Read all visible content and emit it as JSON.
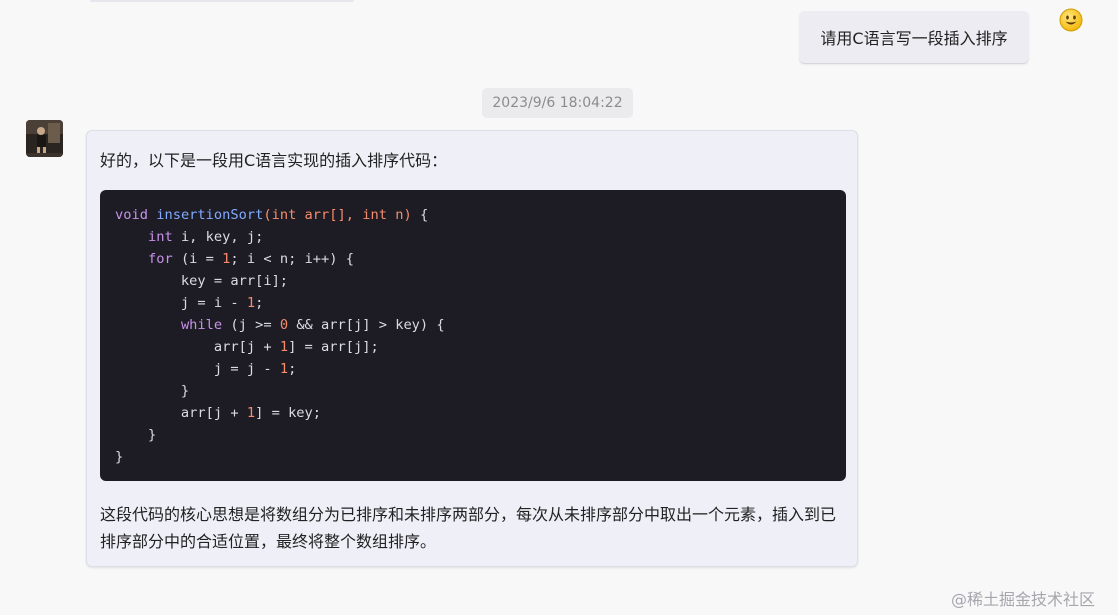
{
  "conversation": {
    "user_message": "请用C语言写一段插入排序",
    "timestamp": "2023/9/6 18:04:22",
    "bot_intro": "好的，以下是一段用C语言实现的插入排序代码：",
    "code_lines": [
      "void insertionSort(int arr[], int n) {",
      "    int i, key, j;",
      "    for (i = 1; i < n; i++) {",
      "        key = arr[i];",
      "        j = i - 1;",
      "        while (j >= 0 && arr[j] > key) {",
      "            arr[j + 1] = arr[j];",
      "            j = j - 1;",
      "        }",
      "        arr[j + 1] = key;",
      "    }",
      "}"
    ],
    "bot_summary": "这段代码的核心思想是将数组分为已排序和未排序两部分，每次从未排序部分中取出一个元素，插入到已排序部分中的合适位置，最终将整个数组排序。"
  },
  "watermark": "@稀土掘金技术社区",
  "colors": {
    "code_background": "#1d1c25",
    "keyword": "#c792ea",
    "function": "#82aaff",
    "number": "#f78c6c",
    "bot_bubble": "#efeff8",
    "user_bubble": "#ececf2"
  },
  "icons": {
    "user_avatar": "smiley-face-icon",
    "bot_avatar": "photo-avatar"
  }
}
